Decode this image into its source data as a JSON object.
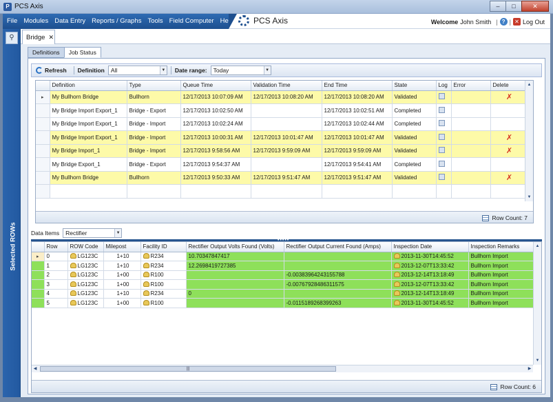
{
  "window": {
    "title": "PCS Axis",
    "icon": "app-icon",
    "minimize": "–",
    "maximize": "□",
    "close": "✕"
  },
  "menu": {
    "items": [
      "File",
      "Modules",
      "Data Entry",
      "Reports / Graphs",
      "Tools",
      "Field Computer",
      "Help"
    ],
    "brand": "PCS Axis",
    "welcome_label": "Welcome",
    "user_name": "John Smith",
    "logout_label": "Log Out"
  },
  "sidebar": {
    "label": "Selected ROWs",
    "search_icon": "search-icon"
  },
  "doc_tab": {
    "label": "Bridge",
    "close": "✕"
  },
  "sub_tabs": [
    "Definitions",
    "Job Status"
  ],
  "toolbar": {
    "refresh_label": "Refresh",
    "definition_label": "Definition",
    "definition_value": "All",
    "date_range_label": "Date range:",
    "date_range_value": "Today"
  },
  "jobs": {
    "columns": [
      "Definition",
      "Type",
      "Queue Time",
      "Validation Time",
      "End Time",
      "State",
      "Log",
      "Error",
      "Delete"
    ],
    "rows": [
      {
        "definition": "My Bullhorn Bridge",
        "type": "Bullhorn",
        "queue": "12/17/2013 10:07:09 AM",
        "validation": "12/17/2013 10:08:20 AM",
        "end": "12/17/2013 10:08:20 AM",
        "state": "Validated",
        "highlight": true,
        "delete": true
      },
      {
        "definition": "My Bridge Import Export_1",
        "type": "Bridge - Export",
        "queue": "12/17/2013 10:02:50 AM",
        "validation": "",
        "end": "12/17/2013 10:02:51 AM",
        "state": "Completed",
        "highlight": false,
        "delete": false
      },
      {
        "definition": "My Bridge Import Export_1",
        "type": "Bridge - Import",
        "queue": "12/17/2013 10:02:24 AM",
        "validation": "",
        "end": "12/17/2013 10:02:44 AM",
        "state": "Completed",
        "highlight": false,
        "delete": false
      },
      {
        "definition": "My Bridge Import Export_1",
        "type": "Bridge - Import",
        "queue": "12/17/2013 10:00:31 AM",
        "validation": "12/17/2013 10:01:47 AM",
        "end": "12/17/2013 10:01:47 AM",
        "state": "Validated",
        "highlight": true,
        "delete": true
      },
      {
        "definition": "My Bridge Import_1",
        "type": "Bridge - Import",
        "queue": "12/17/2013 9:58:56 AM",
        "validation": "12/17/2013 9:59:09 AM",
        "end": "12/17/2013 9:59:09 AM",
        "state": "Validated",
        "highlight": true,
        "delete": true
      },
      {
        "definition": "My Bridge Export_1",
        "type": "Bridge - Export",
        "queue": "12/17/2013 9:54:37 AM",
        "validation": "",
        "end": "12/17/2013 9:54:41 AM",
        "state": "Completed",
        "highlight": false,
        "delete": false
      },
      {
        "definition": "My Bullhorn Bridge",
        "type": "Bullhorn",
        "queue": "12/17/2013 9:50:33 AM",
        "validation": "12/17/2013 9:51:47 AM",
        "end": "12/17/2013 9:51:47 AM",
        "state": "Validated",
        "highlight": true,
        "delete": true
      }
    ],
    "row_count_label": "Row Count:",
    "row_count": "7"
  },
  "data_items": {
    "label": "Data Items",
    "value": "Rectifier"
  },
  "readings": {
    "columns": [
      "Row",
      "ROW Code",
      "Milepost",
      "Facility ID",
      "Rectifier Output Volts Found (Volts)",
      "Rectifier Output Current Found (Amps)",
      "Inspection Date",
      "Inspection Remarks"
    ],
    "rows": [
      {
        "row": "0",
        "code": "LG123C",
        "milepost": "1+10",
        "facility": "R234",
        "volts": "10.70347847417",
        "amps": "",
        "date": "2013-11-30T14:45:52",
        "remarks": "Bullhorn Import"
      },
      {
        "row": "1",
        "code": "LG123C",
        "milepost": "1+10",
        "facility": "R234",
        "volts": "12.2698419727385",
        "amps": "",
        "date": "2013-12-07T13:33:42",
        "remarks": "Bullhorn Import"
      },
      {
        "row": "2",
        "code": "LG123C",
        "milepost": "1+00",
        "facility": "R100",
        "volts": "",
        "amps": "-0.00383964243155788",
        "date": "2013-12-14T13:18:49",
        "remarks": "Bullhorn Import"
      },
      {
        "row": "3",
        "code": "LG123C",
        "milepost": "1+00",
        "facility": "R100",
        "volts": "",
        "amps": "-0.00767928486311575",
        "date": "2013-12-07T13:33:42",
        "remarks": "Bullhorn Import"
      },
      {
        "row": "4",
        "code": "LG123C",
        "milepost": "1+10",
        "facility": "R234",
        "volts": "0",
        "amps": "",
        "date": "2013-12-14T13:18:49",
        "remarks": "Bullhorn Import"
      },
      {
        "row": "5",
        "code": "LG123C",
        "milepost": "1+00",
        "facility": "R100",
        "volts": "",
        "amps": "-0.0115189268399263",
        "date": "2013-11-30T14:45:52",
        "remarks": "Bullhorn Import"
      }
    ],
    "row_count_label": "Row Count:",
    "row_count": "6"
  },
  "colors": {
    "brand_blue": "#1d4f8f",
    "validated_highlight": "#fdfaa8",
    "imported_green": "#8ee05a",
    "delete_red": "#d6301f"
  }
}
